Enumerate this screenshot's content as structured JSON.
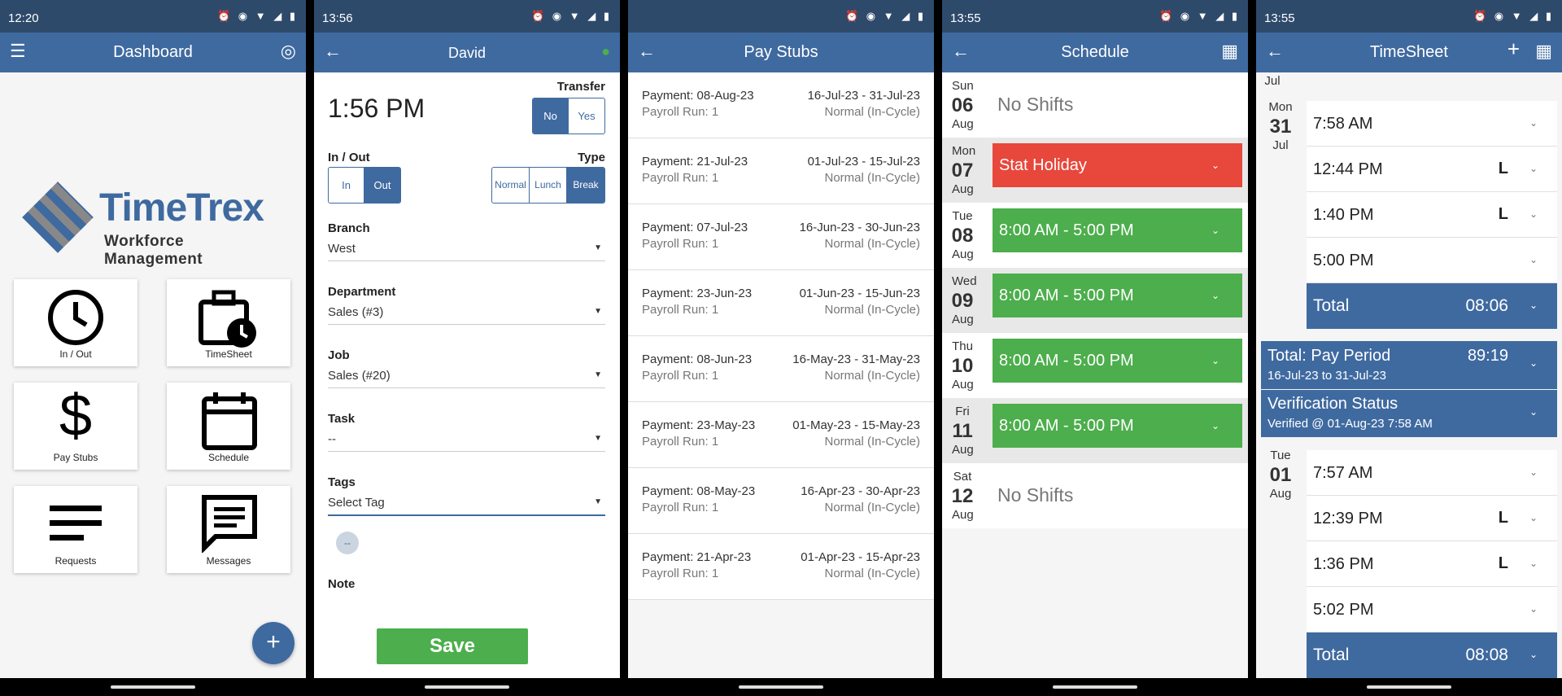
{
  "colors": {
    "appbar": "#3f6aa0",
    "statusbar": "#2e4a6b",
    "green": "#4cae4c",
    "red": "#e8473c"
  },
  "dashboard": {
    "status_time": "12:20",
    "title": "Dashboard",
    "logo_brand": "TimeTrex",
    "logo_sub": "Workforce Management",
    "tiles": [
      {
        "label": "In / Out",
        "icon": "clock-icon"
      },
      {
        "label": "TimeSheet",
        "icon": "briefcase-clock-icon"
      },
      {
        "label": "Pay Stubs",
        "icon": "dollar-icon"
      },
      {
        "label": "Schedule",
        "icon": "calendar-icon"
      },
      {
        "label": "Requests",
        "icon": "lines-icon"
      },
      {
        "label": "Messages",
        "icon": "message-icon"
      }
    ],
    "fab": "+"
  },
  "punch": {
    "status_time": "13:56",
    "title": "David",
    "time": "1:56 PM",
    "transfer_label": "Transfer",
    "transfer_options": [
      "No",
      "Yes"
    ],
    "inout_label": "In / Out",
    "inout_options": [
      "In",
      "Out"
    ],
    "type_label": "Type",
    "type_options": [
      "Normal",
      "Lunch",
      "Break"
    ],
    "branch_label": "Branch",
    "branch_value": "West",
    "department_label": "Department",
    "department_value": "Sales (#3)",
    "job_label": "Job",
    "job_value": "Sales (#20)",
    "task_label": "Task",
    "task_value": "--",
    "tags_label": "Tags",
    "tags_value": "Select Tag",
    "chip": "--",
    "note_label": "Note",
    "save_label": "Save"
  },
  "paystubs": {
    "title": "Pay Stubs",
    "items": [
      {
        "payment": "Payment: 08-Aug-23",
        "run": "Payroll Run: 1",
        "period": "16-Jul-23 - 31-Jul-23",
        "type": "Normal (In-Cycle)"
      },
      {
        "payment": "Payment: 21-Jul-23",
        "run": "Payroll Run: 1",
        "period": "01-Jul-23 - 15-Jul-23",
        "type": "Normal (In-Cycle)"
      },
      {
        "payment": "Payment: 07-Jul-23",
        "run": "Payroll Run: 1",
        "period": "16-Jun-23 - 30-Jun-23",
        "type": "Normal (In-Cycle)"
      },
      {
        "payment": "Payment: 23-Jun-23",
        "run": "Payroll Run: 1",
        "period": "01-Jun-23 - 15-Jun-23",
        "type": "Normal (In-Cycle)"
      },
      {
        "payment": "Payment: 08-Jun-23",
        "run": "Payroll Run: 1",
        "period": "16-May-23 - 31-May-23",
        "type": "Normal (In-Cycle)"
      },
      {
        "payment": "Payment: 23-May-23",
        "run": "Payroll Run: 1",
        "period": "01-May-23 - 15-May-23",
        "type": "Normal (In-Cycle)"
      },
      {
        "payment": "Payment: 08-May-23",
        "run": "Payroll Run: 1",
        "period": "16-Apr-23 - 30-Apr-23",
        "type": "Normal (In-Cycle)"
      },
      {
        "payment": "Payment: 21-Apr-23",
        "run": "Payroll Run: 1",
        "period": "01-Apr-23 - 15-Apr-23",
        "type": "Normal (In-Cycle)"
      }
    ]
  },
  "schedule": {
    "status_time": "13:55",
    "title": "Schedule",
    "days": [
      {
        "dow": "Sun",
        "num": "06",
        "mon": "Aug",
        "text": "No Shifts",
        "kind": "none"
      },
      {
        "dow": "Mon",
        "num": "07",
        "mon": "Aug",
        "text": "Stat Holiday",
        "kind": "holiday"
      },
      {
        "dow": "Tue",
        "num": "08",
        "mon": "Aug",
        "text": "8:00 AM - 5:00 PM",
        "kind": "shift"
      },
      {
        "dow": "Wed",
        "num": "09",
        "mon": "Aug",
        "text": "8:00 AM - 5:00 PM",
        "kind": "shift"
      },
      {
        "dow": "Thu",
        "num": "10",
        "mon": "Aug",
        "text": "8:00 AM - 5:00 PM",
        "kind": "shift"
      },
      {
        "dow": "Fri",
        "num": "11",
        "mon": "Aug",
        "text": "8:00 AM - 5:00 PM",
        "kind": "shift"
      },
      {
        "dow": "Sat",
        "num": "12",
        "mon": "Aug",
        "text": "No Shifts",
        "kind": "none"
      }
    ]
  },
  "timesheet": {
    "status_time": "13:55",
    "title": "TimeSheet",
    "prev_month": "Jul",
    "day1": {
      "dow": "Mon",
      "num": "31",
      "mon": "Jul",
      "punches": [
        {
          "time": "7:58 AM",
          "tag": ""
        },
        {
          "time": "12:44 PM",
          "tag": "L"
        },
        {
          "time": "1:40 PM",
          "tag": "L"
        },
        {
          "time": "5:00 PM",
          "tag": ""
        }
      ],
      "total_label": "Total",
      "total_value": "08:06"
    },
    "pay_period": {
      "label": "Total: Pay Period",
      "value": "89:19",
      "range": "16-Jul-23  to  31-Jul-23"
    },
    "verification": {
      "label": "Verification Status",
      "detail": "Verified @ 01-Aug-23 7:58 AM"
    },
    "day2": {
      "dow": "Tue",
      "num": "01",
      "mon": "Aug",
      "punches": [
        {
          "time": "7:57 AM",
          "tag": ""
        },
        {
          "time": "12:39 PM",
          "tag": "L"
        },
        {
          "time": "1:36 PM",
          "tag": "L"
        },
        {
          "time": "5:02 PM",
          "tag": ""
        }
      ],
      "total_label": "Total",
      "total_value": "08:08"
    }
  }
}
